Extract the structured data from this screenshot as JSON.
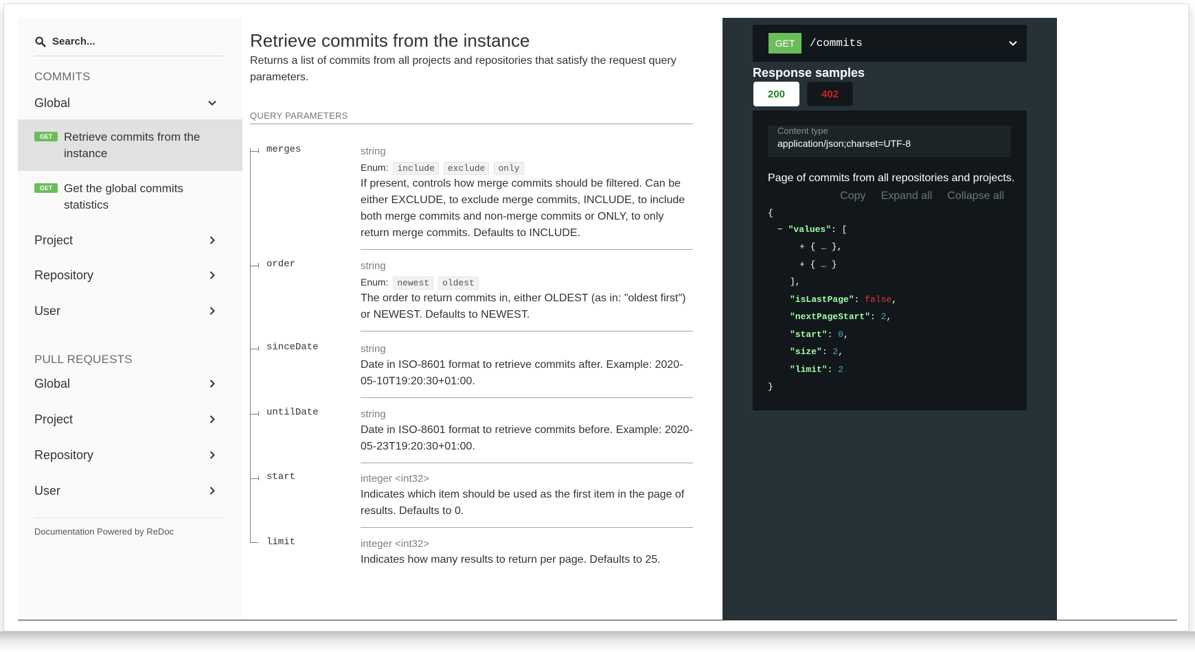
{
  "sidebar": {
    "search_placeholder": "Search...",
    "commits_group": "COMMITS",
    "commits_global": "Global",
    "ops": [
      {
        "method": "GET",
        "label": "Retrieve commits from the instance"
      },
      {
        "method": "GET",
        "label": "Get the global commits statistics"
      }
    ],
    "commits_items": [
      "Project",
      "Repository",
      "User"
    ],
    "pr_group": "PULL REQUESTS",
    "pr_items": [
      "Global",
      "Project",
      "Repository",
      "User"
    ],
    "powered_by": "Documentation Powered by ReDoc"
  },
  "operation": {
    "title": "Retrieve commits from the instance",
    "description": "Returns a list of commits from all projects and repositories that satisfy the request query parameters.",
    "query_params_header": "QUERY PARAMETERS",
    "params": [
      {
        "name": "merges",
        "type": "string",
        "enum_label": "Enum:",
        "enum": [
          "include",
          "exclude",
          "only"
        ],
        "description": "If present, controls how merge commits should be filtered. Can be either EXCLUDE, to exclude merge commits, INCLUDE, to include both merge commits and non-merge commits or ONLY, to only return merge commits. Defaults to INCLUDE."
      },
      {
        "name": "order",
        "type": "string",
        "enum_label": "Enum:",
        "enum": [
          "newest",
          "oldest"
        ],
        "description": "The order to return commits in, either OLDEST (as in: \"oldest first\") or NEWEST. Defaults to NEWEST."
      },
      {
        "name": "sinceDate",
        "type": "string",
        "description": "Date in ISO-8601 format to retrieve commits after. Example: 2020-05-10T19:20:30+01:00."
      },
      {
        "name": "untilDate",
        "type": "string",
        "description": "Date in ISO-8601 format to retrieve commits before. Example: 2020-05-23T19:20:30+01:00."
      },
      {
        "name": "start",
        "type": "integer <int32>",
        "description": "Indicates which item should be used as the first item in the page of results. Defaults to 0."
      },
      {
        "name": "limit",
        "type": "integer <int32>",
        "description": "Indicates how many results to return per page. Defaults to 25."
      }
    ]
  },
  "panel": {
    "method": "GET",
    "path": "/commits",
    "samples_title": "Response samples",
    "tab_ok": "200",
    "tab_err": "402",
    "content_type_label": "Content type",
    "content_type": "application/json;charset=UTF-8",
    "response_description": "Page of commits from all repositories and projects.",
    "actions": [
      "Copy",
      "Expand all",
      "Collapse all"
    ],
    "json": {
      "open_brace": "{",
      "close_brace": "}",
      "collapse_toggle": "−",
      "values_key": "\"values\"",
      "values_open": ": [",
      "item1": "+ { … },",
      "item2": "+ { … }",
      "values_close": "],",
      "isLastPage_key": "\"isLastPage\"",
      "isLastPage_val": "false",
      "nextPageStart_key": "\"nextPageStart\"",
      "nextPageStart_val": "2",
      "start_key": "\"start\"",
      "start_val": "0",
      "size_key": "\"size\"",
      "size_val": "2",
      "limit_key": "\"limit\"",
      "limit_val": "2",
      "colon": ": ",
      "comma": ","
    }
  },
  "colors": {
    "get_badge": "#6bbd5b",
    "panel_bg": "#263238",
    "code_bg": "#11171a",
    "json_key": "#a0fbaa",
    "json_number": "#4ba6c8",
    "json_boolean": "#e53935",
    "status_ok": "#1d8127",
    "status_err": "#d41f1c"
  }
}
